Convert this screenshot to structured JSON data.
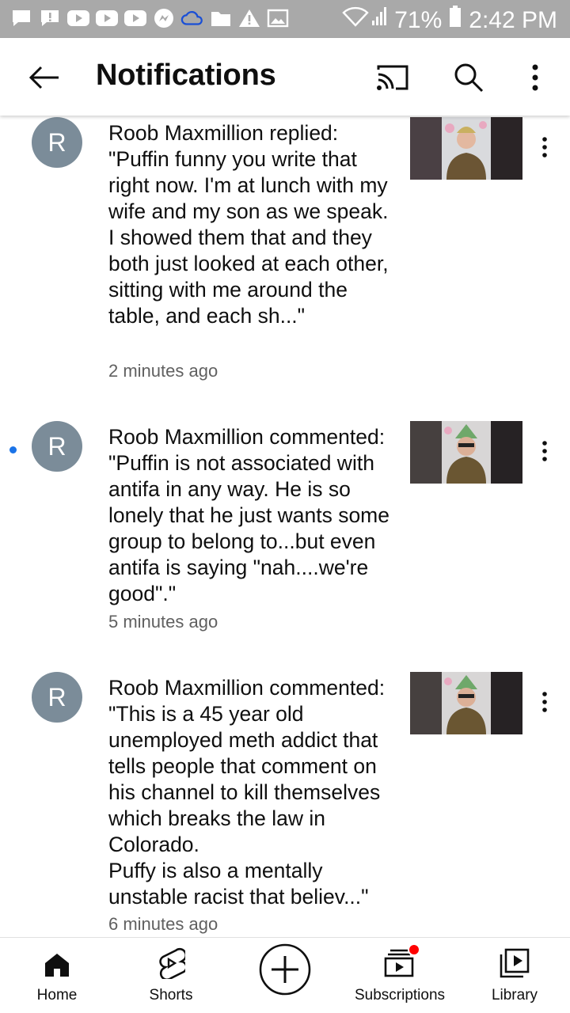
{
  "status_bar": {
    "battery_percent": "71%",
    "time": "2:42 PM",
    "left_icons": [
      "message-icon",
      "message-alert-icon",
      "youtube-icon",
      "youtube-icon",
      "youtube-icon",
      "messenger-icon",
      "onedrive-icon",
      "folder-icon",
      "warning-icon",
      "image-icon"
    ]
  },
  "app_bar": {
    "title": "Notifications"
  },
  "notifications": [
    {
      "avatar_letter": "R",
      "unread": false,
      "text": "Roob Maxmillion replied: \"Puffin funny you write that right now. I'm at lunch with my wife and my son as we speak. I showed them that and they both just looked at each other, sitting with me around the table, and each sh...\"",
      "time": "2 minutes ago"
    },
    {
      "avatar_letter": "R",
      "unread": true,
      "text": "Roob Maxmillion commented: \"Puffin is not associated with antifa in any way. He is so lonely that he just wants some group to belong to...but even antifa is saying \"nah....we're good\".\"",
      "time": "5 minutes ago"
    },
    {
      "avatar_letter": "R",
      "unread": false,
      "text": "Roob Maxmillion commented: \"This is a 45 year old unemployed meth addict that tells people that comment on his channel to kill themselves which breaks the law in Colorado.\nPuffy is also a mentally unstable racist that believ...\"",
      "time": "6 minutes ago"
    }
  ],
  "bottom_nav": {
    "home": "Home",
    "shorts": "Shorts",
    "subscriptions": "Subscriptions",
    "library": "Library"
  },
  "colors": {
    "accent_blue": "#1a73e8",
    "avatar_bg": "#7b8c99",
    "badge_red": "#ff0000",
    "status_bar_bg": "#a9a9a9"
  }
}
